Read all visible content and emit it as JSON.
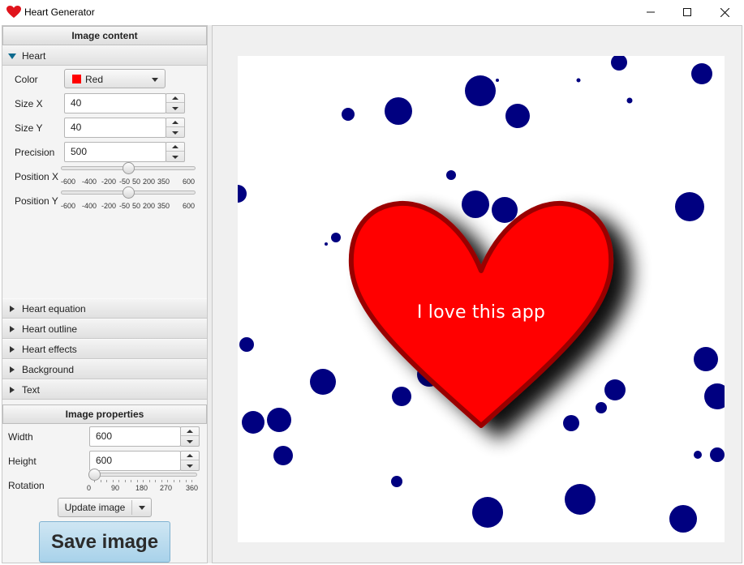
{
  "window": {
    "title": "Heart Generator",
    "icon": "heart-icon"
  },
  "image_content": {
    "header": "Image content",
    "heart": {
      "label": "Heart",
      "color_label": "Color",
      "color_value": "Red",
      "color_hex": "#ff0000",
      "size_x_label": "Size X",
      "size_x_value": "40",
      "size_y_label": "Size Y",
      "size_y_value": "40",
      "precision_label": "Precision",
      "precision_value": "500",
      "position_x_label": "Position X",
      "position_y_label": "Position Y",
      "position_ticks": [
        "-600",
        "-400",
        "-200",
        "-50",
        "50",
        "200",
        "350",
        "600"
      ],
      "position_x_value": 0,
      "position_y_value": 0
    },
    "sections": [
      "Heart equation",
      "Heart outline",
      "Heart effects",
      "Background",
      "Text"
    ]
  },
  "image_properties": {
    "header": "Image properties",
    "width_label": "Width",
    "width_value": "600",
    "height_label": "Height",
    "height_value": "600",
    "rotation_label": "Rotation",
    "rotation_ticks": [
      "0",
      "90",
      "180",
      "270",
      "360"
    ],
    "rotation_value": 0,
    "update_label": "Update image",
    "save_label": "Save image"
  },
  "preview": {
    "heart_text": "I love this app",
    "heart_fill": "#ff0000",
    "heart_outline": "#990000",
    "dot_color": "#000080"
  }
}
